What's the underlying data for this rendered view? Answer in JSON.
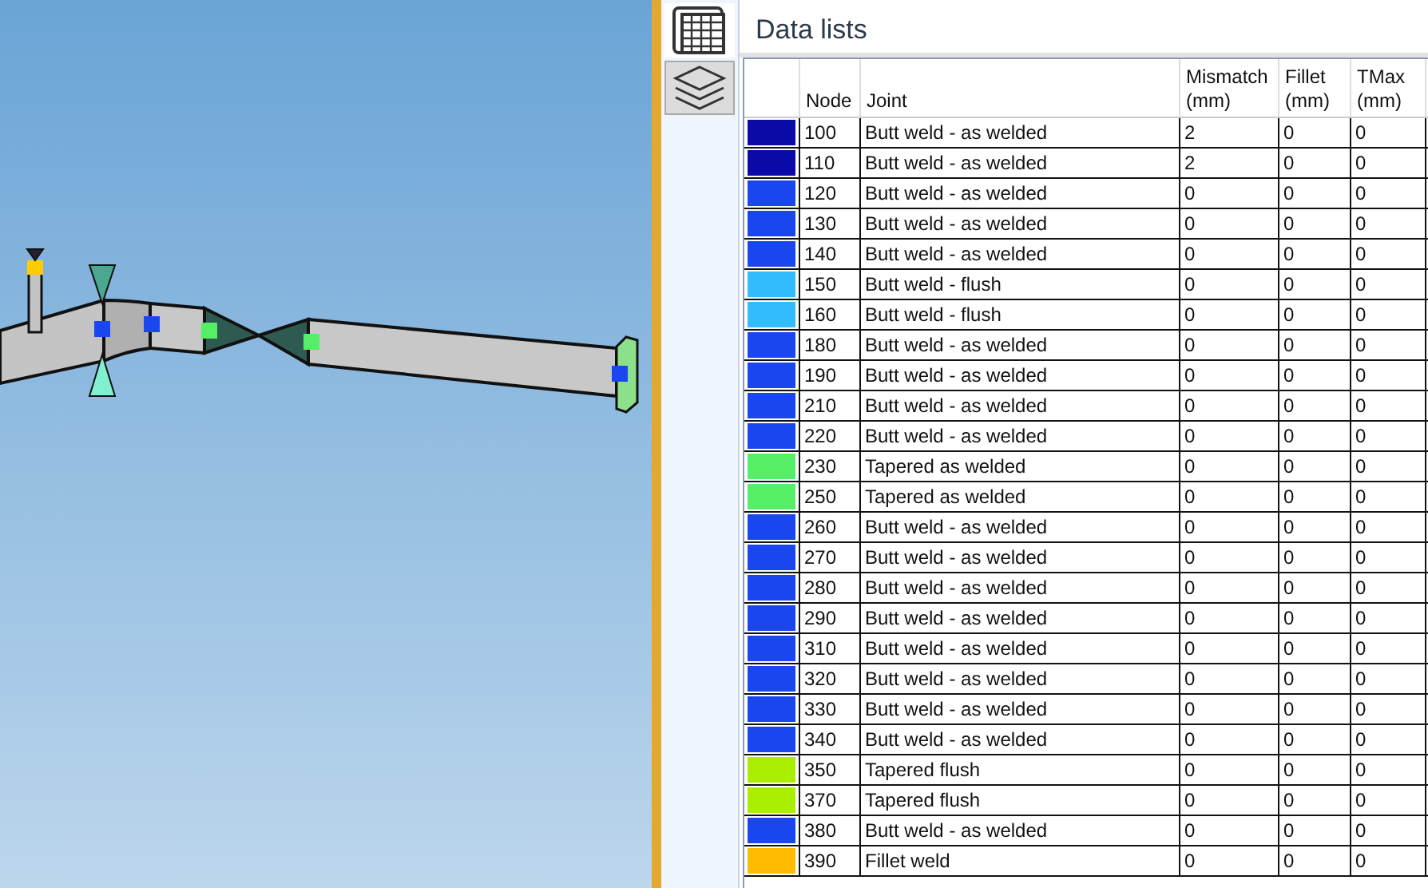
{
  "side_tabs": [
    {
      "kind": "grid",
      "selected": true
    },
    {
      "kind": "layers",
      "selected": false
    }
  ],
  "panel": {
    "title": "Data lists"
  },
  "table": {
    "columns": [
      "Node",
      "Joint",
      "Mismatch (mm)",
      "Fillet (mm)",
      "TMax (mm)"
    ],
    "rows": [
      {
        "color": "#0a0aa8",
        "node": "100",
        "joint": "Butt weld - as welded",
        "mismatch": "2",
        "fillet": "0",
        "tmax": "0"
      },
      {
        "color": "#0a0aa8",
        "node": "110",
        "joint": "Butt weld - as welded",
        "mismatch": "2",
        "fillet": "0",
        "tmax": "0"
      },
      {
        "color": "#1a46f0",
        "node": "120",
        "joint": "Butt weld - as welded",
        "mismatch": "0",
        "fillet": "0",
        "tmax": "0"
      },
      {
        "color": "#1a46f0",
        "node": "130",
        "joint": "Butt weld - as welded",
        "mismatch": "0",
        "fillet": "0",
        "tmax": "0"
      },
      {
        "color": "#1a46f0",
        "node": "140",
        "joint": "Butt weld - as welded",
        "mismatch": "0",
        "fillet": "0",
        "tmax": "0"
      },
      {
        "color": "#33bbff",
        "node": "150",
        "joint": "Butt weld - flush",
        "mismatch": "0",
        "fillet": "0",
        "tmax": "0"
      },
      {
        "color": "#33bbff",
        "node": "160",
        "joint": "Butt weld - flush",
        "mismatch": "0",
        "fillet": "0",
        "tmax": "0"
      },
      {
        "color": "#1a46f0",
        "node": "180",
        "joint": "Butt weld - as welded",
        "mismatch": "0",
        "fillet": "0",
        "tmax": "0"
      },
      {
        "color": "#1a46f0",
        "node": "190",
        "joint": "Butt weld - as welded",
        "mismatch": "0",
        "fillet": "0",
        "tmax": "0"
      },
      {
        "color": "#1a46f0",
        "node": "210",
        "joint": "Butt weld - as welded",
        "mismatch": "0",
        "fillet": "0",
        "tmax": "0"
      },
      {
        "color": "#1a46f0",
        "node": "220",
        "joint": "Butt weld - as welded",
        "mismatch": "0",
        "fillet": "0",
        "tmax": "0"
      },
      {
        "color": "#55ee66",
        "node": "230",
        "joint": "Tapered as welded",
        "mismatch": "0",
        "fillet": "0",
        "tmax": "0"
      },
      {
        "color": "#55ee66",
        "node": "250",
        "joint": "Tapered as welded",
        "mismatch": "0",
        "fillet": "0",
        "tmax": "0"
      },
      {
        "color": "#1a46f0",
        "node": "260",
        "joint": "Butt weld - as welded",
        "mismatch": "0",
        "fillet": "0",
        "tmax": "0"
      },
      {
        "color": "#1a46f0",
        "node": "270",
        "joint": "Butt weld - as welded",
        "mismatch": "0",
        "fillet": "0",
        "tmax": "0"
      },
      {
        "color": "#1a46f0",
        "node": "280",
        "joint": "Butt weld - as welded",
        "mismatch": "0",
        "fillet": "0",
        "tmax": "0"
      },
      {
        "color": "#1a46f0",
        "node": "290",
        "joint": "Butt weld - as welded",
        "mismatch": "0",
        "fillet": "0",
        "tmax": "0"
      },
      {
        "color": "#1a46f0",
        "node": "310",
        "joint": "Butt weld - as welded",
        "mismatch": "0",
        "fillet": "0",
        "tmax": "0"
      },
      {
        "color": "#1a46f0",
        "node": "320",
        "joint": "Butt weld - as welded",
        "mismatch": "0",
        "fillet": "0",
        "tmax": "0"
      },
      {
        "color": "#1a46f0",
        "node": "330",
        "joint": "Butt weld - as welded",
        "mismatch": "0",
        "fillet": "0",
        "tmax": "0"
      },
      {
        "color": "#1a46f0",
        "node": "340",
        "joint": "Butt weld - as welded",
        "mismatch": "0",
        "fillet": "0",
        "tmax": "0"
      },
      {
        "color": "#aaee00",
        "node": "350",
        "joint": "Tapered flush",
        "mismatch": "0",
        "fillet": "0",
        "tmax": "0"
      },
      {
        "color": "#aaee00",
        "node": "370",
        "joint": "Tapered flush",
        "mismatch": "0",
        "fillet": "0",
        "tmax": "0"
      },
      {
        "color": "#1a46f0",
        "node": "380",
        "joint": "Butt weld - as welded",
        "mismatch": "0",
        "fillet": "0",
        "tmax": "0"
      },
      {
        "color": "#ffbb00",
        "node": "390",
        "joint": "Fillet weld",
        "mismatch": "0",
        "fillet": "0",
        "tmax": "0"
      }
    ]
  }
}
